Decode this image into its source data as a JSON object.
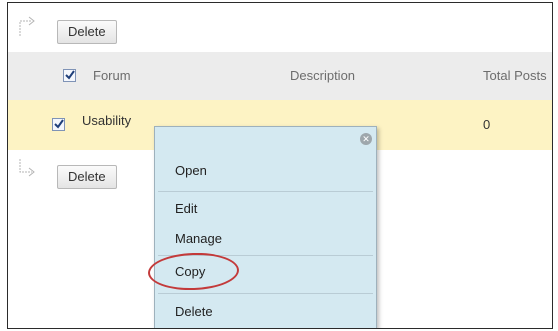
{
  "toolbar": {
    "delete_label": "Delete"
  },
  "table": {
    "headers": {
      "forum": "Forum",
      "description": "Description",
      "total_posts": "Total Posts"
    },
    "rows": [
      {
        "forum": "Usability",
        "description": "",
        "total_posts": "0",
        "checked": true
      }
    ],
    "header_checkbox_checked": true
  },
  "bottom_toolbar": {
    "delete_label": "Delete"
  },
  "context_menu": {
    "items": [
      {
        "label": "Open"
      },
      {
        "label": "Edit"
      },
      {
        "label": "Manage"
      },
      {
        "label": "Copy",
        "highlighted": true
      },
      {
        "label": "Delete"
      }
    ],
    "close_icon": "close-circle-icon"
  },
  "colors": {
    "menu_bg": "#d4e9f1",
    "selected_row_bg": "#fdf3c4",
    "header_bg": "#ececec",
    "highlight_ring": "#c33a3a"
  }
}
